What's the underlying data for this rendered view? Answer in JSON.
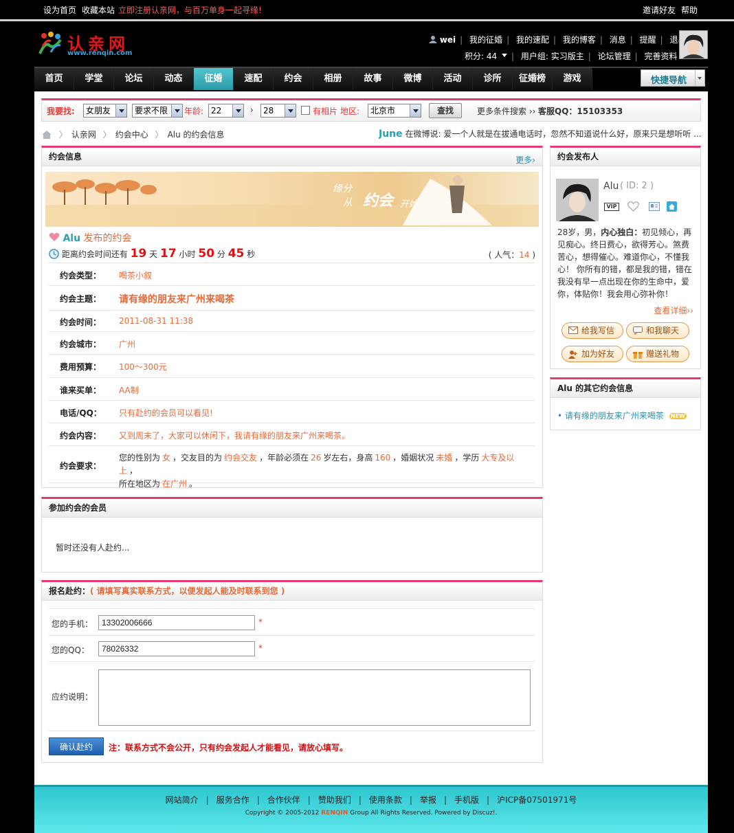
{
  "topbar": {
    "set_home": "设为首页",
    "bookmark": "收藏本站",
    "promo": "立即注册认亲网，与百万单身一起寻缘!",
    "invite": "邀请好友",
    "help": "帮助"
  },
  "logo": {
    "title": "认亲网",
    "url": "www.renqin.com"
  },
  "usermenu": {
    "username": "wei",
    "my_zhenghun": "我的征婚",
    "my_suppei": "我的速配",
    "my_blog": "我的博客",
    "messages": "消息",
    "reminders": "提醒",
    "logout": "退出",
    "points": "积分: 44",
    "usergroup": "用户组: 实习版主",
    "forum_admin": "论坛管理",
    "complete_profile": "完善资料"
  },
  "nav": {
    "items": [
      "首页",
      "学堂",
      "论坛",
      "动态",
      "征婚",
      "速配",
      "约会",
      "相册",
      "故事",
      "微博",
      "活动",
      "诊所",
      "征婚榜",
      "游戏"
    ],
    "active_index": 4,
    "quick": "快捷导航"
  },
  "search": {
    "label": "我要找:",
    "who": "女朋友",
    "require": "要求不限",
    "age_label": "年龄:",
    "age_from": "22",
    "age_to": "28",
    "photo_label": "有相片",
    "area_label": "地区:",
    "area": "北京市",
    "submit": "查找",
    "more": "更多条件搜索 ››",
    "qq": "客服QQ：15103353"
  },
  "breadcrumb": {
    "home": "认亲网",
    "center": "约会中心",
    "current": "Alu 的约会信息"
  },
  "ticker": {
    "name": "June",
    "text": "在微博说: 爱一个人就是在拔通电话时，忽然不知道说什么好，原来只是想听听 ..."
  },
  "date_panel": {
    "title": "约会信息",
    "more": "更多›",
    "banner_text1": "缘分",
    "banner_text2": "从",
    "banner_text3": "约会",
    "banner_text4": "开始",
    "poster_name": "Alu",
    "poster_suffix": "发布的约会",
    "countdown_label": "距离约会时间还有",
    "days": "19",
    "days_unit": "天",
    "hours": "17",
    "hours_unit": "小时",
    "minutes": "50",
    "minutes_unit": "分",
    "seconds": "45",
    "seconds_unit": "秒",
    "popularity_label": "( 人气：",
    "popularity": "14",
    "popularity_end": ")",
    "rows": [
      {
        "k": "约会类型：",
        "v": "喝茶小叙"
      },
      {
        "k": "约会主题：",
        "v": "请有缘的朋友来广州来喝茶"
      },
      {
        "k": "约会时间：",
        "v": "2011-08-31 11:38"
      },
      {
        "k": "约会城市：",
        "v": "广州"
      },
      {
        "k": "费用预算：",
        "v": "100～300元"
      },
      {
        "k": "谁来买单：",
        "v": "AA制"
      },
      {
        "k": "电话/QQ：",
        "v": "只有赴约的会员可以看见!"
      },
      {
        "k": "约会内容：",
        "v": "又到周末了，大家可以休闲下，我请有缘的朋友来广州来喝茶。"
      },
      {
        "k": "约会要求：",
        "v": ""
      }
    ],
    "req": {
      "p1": "您的性别为",
      "gender": "女",
      "p2": "，交友目的为",
      "purpose": "约会交友",
      "p3": "，年龄必须在",
      "age": "26",
      "p4": "岁左右，身高",
      "height": "160",
      "p5": "，婚姻状况",
      "marital": "未婚",
      "p6": "，学历",
      "edu": "大专及以上",
      "p7": "，",
      "p8": "所在地区为",
      "region": "在广州",
      "p9": "。"
    }
  },
  "members_panel": {
    "title": "参加约会的会员",
    "empty": "暂时还没有人赴约..."
  },
  "signup_panel": {
    "title": "报名赴约：",
    "title_note": "( 请填写真实联系方式，以便发起人能及时联系到您 )",
    "phone_label": "您的手机：",
    "phone_value": "13302006666",
    "qq_label": "您的QQ：",
    "qq_value": "78026332",
    "note_label": "应约说明：",
    "submit": "确认赴约",
    "notice": "注：联系方式不会公开，只有约会发起人才能看见，请放心填写。",
    "required": "*"
  },
  "poster_panel": {
    "title": "约会发布人",
    "name": "Alu",
    "id_label": "( ID: 2 )",
    "vip": "VIP",
    "bio_p1": "28岁，男，",
    "bio_bold": "内心独白：",
    "bio_p2": "初见倾心，再见痴心。终日费心，欲得芳心。煞费苦心，想得催心。难道你心，不懂我心！ 你所有的错，都是我的错，错在我没有早一点出现在你的生命中，爱你，体贴你！我会用心弥补你！",
    "more": "查看详细››",
    "btn_mail": "给我写信",
    "btn_chat": "和我聊天",
    "btn_friend": "加为好友",
    "btn_gift": "赠送礼物"
  },
  "other_panel": {
    "title": "Alu 的其它约会信息",
    "item": "请有缘的朋友来广州来喝茶",
    "new_badge": "NEW"
  },
  "footer": {
    "links": [
      "网站简介",
      "服务合作",
      "合作伙伴",
      "赞助我们",
      "使用条款",
      "举报",
      "手机版",
      "沪ICP备07501971号"
    ],
    "copy_pre": "Copyright © 2005-2012",
    "copy_brand": "RENQIN",
    "copy_post": "Group All Rights Reserved. Powered by Discuz!."
  },
  "colors": {
    "accent": "#e33a72",
    "nav_active": "#2fa3b0",
    "orange": "#e26b3b",
    "red": "#e01010"
  }
}
